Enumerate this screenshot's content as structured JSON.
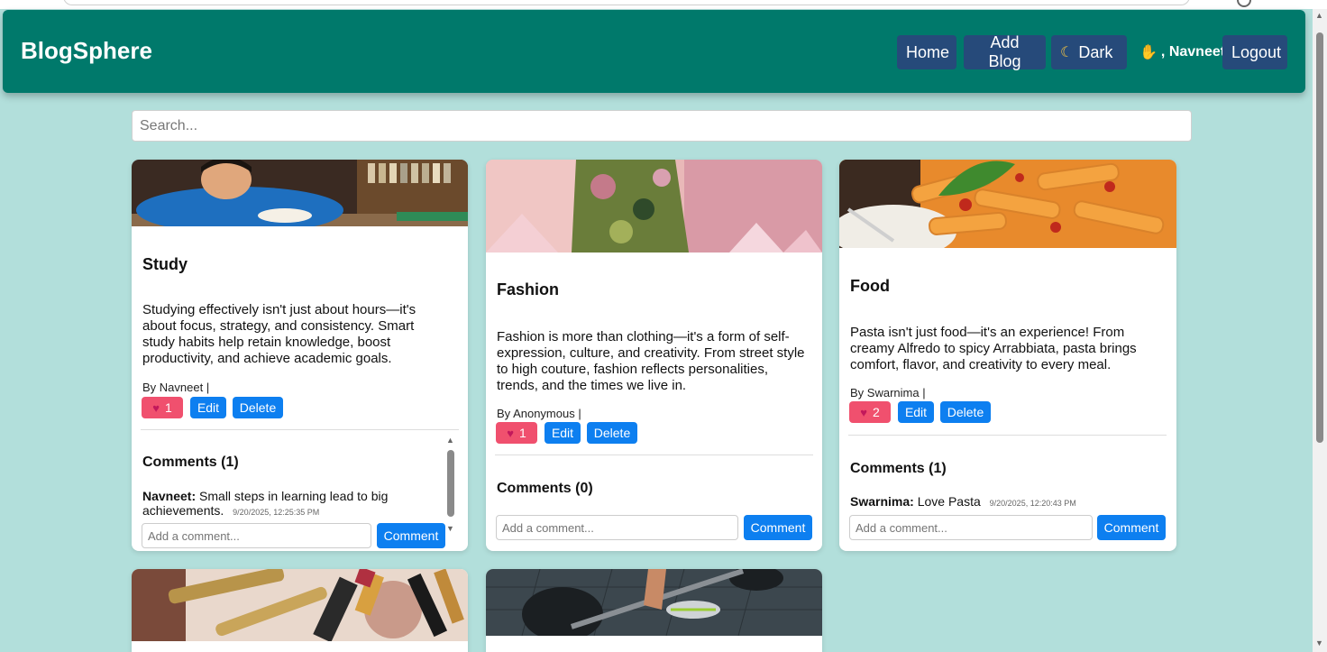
{
  "app": {
    "brand": "BlogSphere"
  },
  "nav": {
    "home": "Home",
    "add_blog": "Add Blog",
    "dark_label": "Dark",
    "greeting": ", Navneet",
    "logout": "Logout"
  },
  "search": {
    "placeholder": "Search..."
  },
  "buttons": {
    "edit": "Edit",
    "delete": "Delete",
    "comment": "Comment",
    "comment_placeholder": "Add a comment..."
  },
  "posts": [
    {
      "title": "Study",
      "text": "Studying effectively isn't just about hours—it's about focus, strategy, and consistency. Smart study habits help retain knowledge, boost productivity, and achieve academic goals.",
      "byline": "By Navneet |",
      "likes": "1",
      "comments_title": "Comments (1)",
      "comments": [
        {
          "author": "Navneet:",
          "text": "Small steps in learning lead to big achievements.",
          "time": "9/20/2025, 12:25:35 PM"
        }
      ]
    },
    {
      "title": "Fashion",
      "text": "Fashion is more than clothing—it's a form of self-expression, culture, and creativity. From street style to high couture, fashion reflects personalities, trends, and the times we live in.",
      "byline": "By Anonymous |",
      "likes": "1",
      "comments_title": "Comments (0)",
      "comments": []
    },
    {
      "title": "Food",
      "text": "Pasta isn't just food—it's an experience! From creamy Alfredo to spicy Arrabbiata, pasta brings comfort, flavor, and creativity to every meal.",
      "byline": "By Swarnima |",
      "likes": "2",
      "comments_title": "Comments (1)",
      "comments": [
        {
          "author": "Swarnima:",
          "text": "Love Pasta",
          "time": "9/20/2025, 12:20:43 PM"
        }
      ]
    }
  ],
  "colors": {
    "header": "#00796b",
    "nav_button": "#264a7a",
    "background": "#b2dfdb",
    "primary": "#0d7ff0",
    "like": "#f0506e"
  }
}
